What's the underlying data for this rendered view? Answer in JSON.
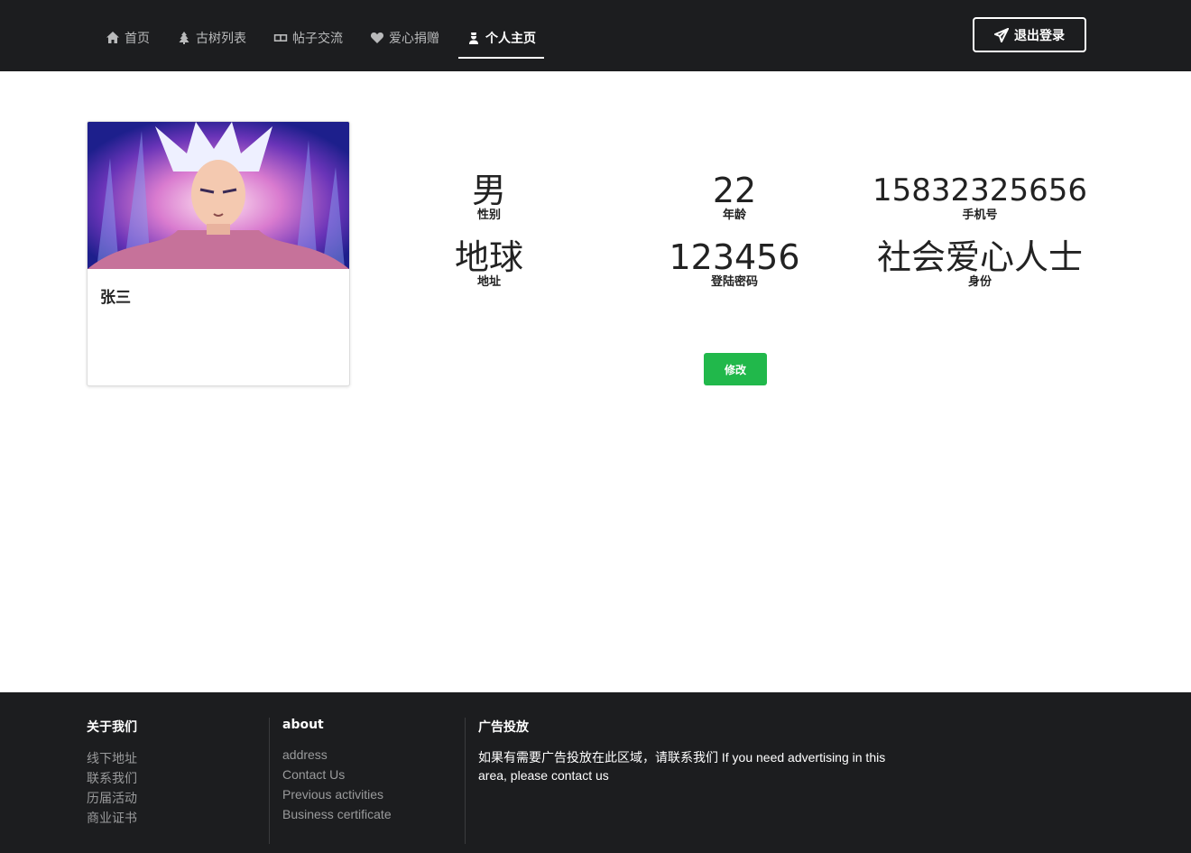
{
  "nav": {
    "items": [
      {
        "label": "首页",
        "icon": "home-icon"
      },
      {
        "label": "古树列表",
        "icon": "tree-icon"
      },
      {
        "label": "帖子交流",
        "icon": "card-icon"
      },
      {
        "label": "爱心捐赠",
        "icon": "heart-icon"
      },
      {
        "label": "个人主页",
        "icon": "user-icon",
        "active": true
      }
    ],
    "logout_label": "退出登录",
    "logout_icon": "paper-plane-icon"
  },
  "profile": {
    "name": "张三",
    "avatar_icon": "avatar-image"
  },
  "info": {
    "gender": {
      "value": "男",
      "label": "性别"
    },
    "age": {
      "value": "22",
      "label": "年龄"
    },
    "phone": {
      "value": "15832325656",
      "label": "手机号"
    },
    "address": {
      "value": "地球",
      "label": "地址"
    },
    "password": {
      "value": "123456",
      "label": "登陆密码"
    },
    "role": {
      "value": "社会爱心人士",
      "label": "身份"
    }
  },
  "edit_label": "修改",
  "footer": {
    "col1": {
      "title": "关于我们",
      "links": [
        "线下地址",
        "联系我们",
        "历届活动",
        "商业证书"
      ]
    },
    "col2": {
      "title": "about",
      "links": [
        "address",
        "Contact Us",
        "Previous activities",
        "Business certificate"
      ]
    },
    "col3": {
      "title": "广告投放",
      "text": "如果有需要广告投放在此区域，请联系我们 If you need advertising in this area, please contact us"
    }
  },
  "colors": {
    "nav_bg": "#1c1d1f",
    "accent_green": "#21b84b",
    "footer_bg": "#1c1d1f"
  }
}
